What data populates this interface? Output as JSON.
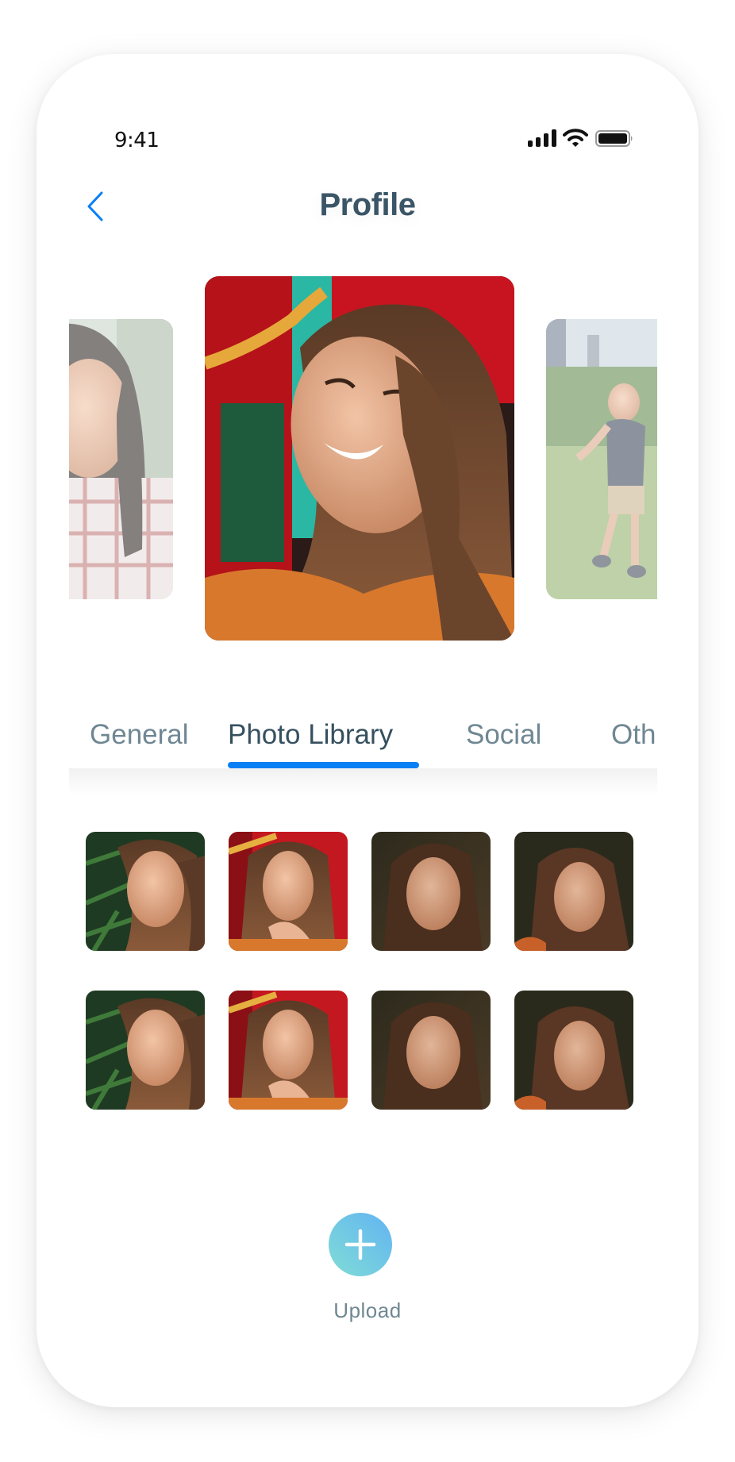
{
  "status_bar": {
    "time": "9:41",
    "icons": [
      "cellular-signal-icon",
      "wifi-icon",
      "battery-icon"
    ]
  },
  "header": {
    "back_icon": "chevron-left-icon",
    "title": "Profile"
  },
  "carousel": {
    "items": [
      {
        "subject": "woman in plaid shirt",
        "state": "previous"
      },
      {
        "subject": "smiling young woman with long brown hair",
        "state": "current"
      },
      {
        "subject": "boy running on grass",
        "state": "next"
      }
    ]
  },
  "tabs": {
    "items": [
      {
        "label": "General",
        "active": false
      },
      {
        "label": "Photo Library",
        "active": true
      },
      {
        "label": "Social",
        "active": false
      },
      {
        "label": "Oth",
        "active": false
      }
    ]
  },
  "photo_grid": {
    "rows": [
      [
        "portrait-leaves",
        "portrait-red-background",
        "portrait-dark-forest",
        "portrait-dark-smile"
      ],
      [
        "portrait-leaves",
        "portrait-red-background",
        "portrait-dark-forest",
        "portrait-dark-smile"
      ]
    ]
  },
  "upload": {
    "icon": "plus-icon",
    "label": "Upload"
  },
  "colors": {
    "accent": "#0a80f5",
    "title": "#3a5566",
    "tab_inactive": "#6f8793",
    "upload_gradient_start": "#80dcd6",
    "upload_gradient_end": "#62b4f2"
  }
}
